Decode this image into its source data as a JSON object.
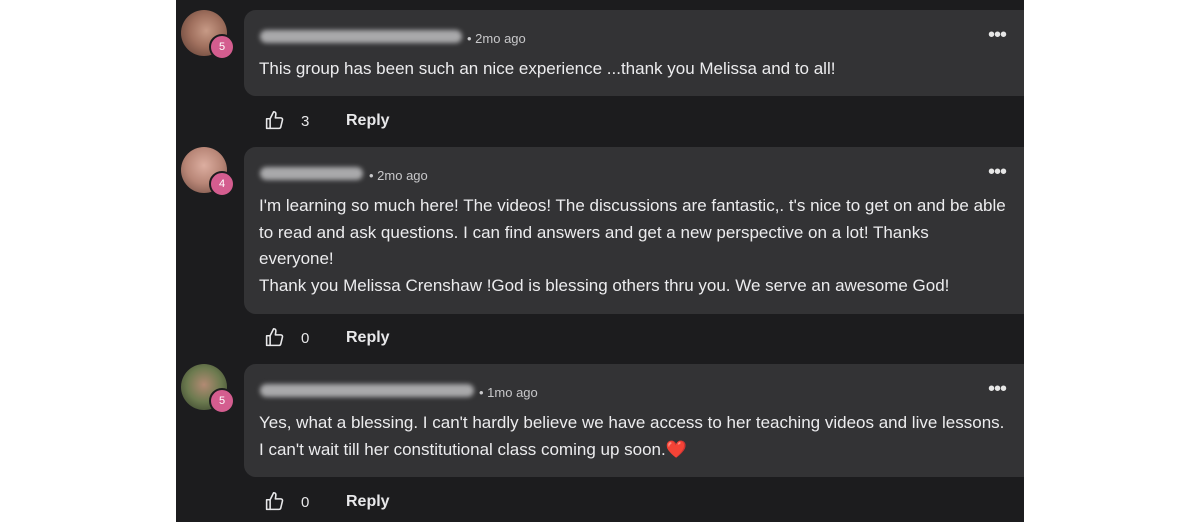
{
  "comments": [
    {
      "time": "• 2mo ago",
      "level": "5",
      "text": "This group has been such an nice experience ...thank you Melissa and to all!",
      "likes": "3",
      "reply_label": "Reply",
      "more_label": "•••"
    },
    {
      "time": "• 2mo ago",
      "level": "4",
      "text": "I'm learning so much here! The videos! The discussions are fantastic,. t's nice to get on and be able to read and ask questions. I can find answers and get a new perspective on a lot! Thanks everyone!\nThank you Melissa Crenshaw !God is blessing others thru you. We serve an awesome God!",
      "likes": "0",
      "reply_label": "Reply",
      "more_label": "•••"
    },
    {
      "time": "• 1mo ago",
      "level": "5",
      "text": "Yes, what a blessing. I can't hardly believe we have access to her teaching videos and live lessons. I can't wait till her constitutional class coming up soon.❤️",
      "likes": "0",
      "reply_label": "Reply",
      "more_label": "•••"
    }
  ],
  "colors": {
    "feed_bg": "#1c1c1e",
    "bubble_bg": "#333335",
    "level_badge": "#d45d8f"
  },
  "icons": {
    "like": "thumbs-up-icon",
    "more": "more-options-icon"
  }
}
